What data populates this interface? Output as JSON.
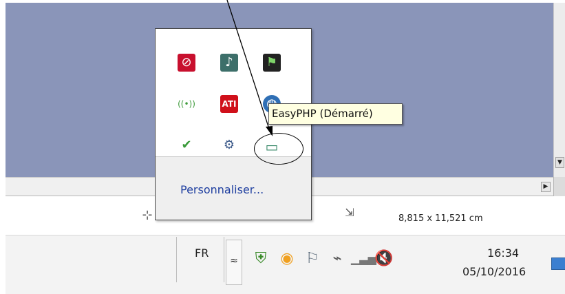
{
  "popup": {
    "customize_label": "Personnaliser...",
    "icons": [
      {
        "name": "opera-icon",
        "glyph": "⊘"
      },
      {
        "name": "music-player-icon",
        "glyph": "♪"
      },
      {
        "name": "media-app-icon",
        "glyph": "⚑"
      },
      {
        "name": "wifi-antenna-icon",
        "glyph": "((•))"
      },
      {
        "name": "ati-icon",
        "glyph": "ATI"
      },
      {
        "name": "network-globe-icon",
        "glyph": "◍"
      },
      {
        "name": "sync-check-icon",
        "glyph": "✔"
      },
      {
        "name": "device-settings-icon",
        "glyph": "⚙"
      },
      {
        "name": "easyphp-icon",
        "glyph": "▭"
      }
    ]
  },
  "tooltip": {
    "text": "EasyPHP (Démarré)"
  },
  "statusbar": {
    "dimensions": "8,815 x 11,521 cm"
  },
  "taskbar": {
    "language": "FR",
    "expand_glyph": "≈",
    "time": "16:34",
    "date": "05/10/2016"
  },
  "colors": {
    "desktop": "#8a95b9",
    "link": "#1f3fa0",
    "tooltip_bg": "#ffffe1"
  }
}
